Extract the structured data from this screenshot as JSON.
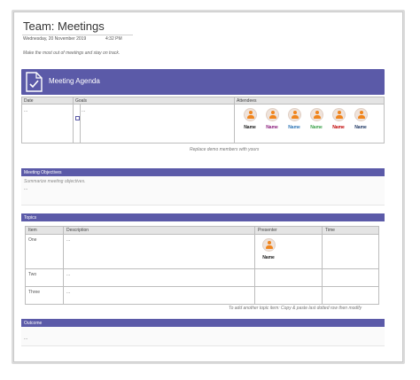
{
  "header": {
    "title": "Team: Meetings",
    "date": "Wednesday, 20 November 2019",
    "time": "4:32 PM",
    "subtitle": "Make the most out of meetings and stay on track."
  },
  "banner": {
    "title": "Meeting Agenda",
    "icon": "clipboard-check-icon"
  },
  "agenda": {
    "headers": {
      "date": "Date",
      "goals": "Goals",
      "attendees": "Attendees"
    },
    "date_value": "...",
    "goals_value": "...",
    "attendees": [
      {
        "name": "Name",
        "color": "#1a1a1a"
      },
      {
        "name": "Name",
        "color": "#8a1c7c"
      },
      {
        "name": "Name",
        "color": "#2e75b6"
      },
      {
        "name": "Name",
        "color": "#3aa14a"
      },
      {
        "name": "Name",
        "color": "#c00000"
      },
      {
        "name": "Name",
        "color": "#1f3864"
      }
    ],
    "caption": "Replace demo members with yours"
  },
  "objectives": {
    "title": "Meeting Objectives",
    "placeholder": "Summarize meeting objectives.",
    "value": "..."
  },
  "topics": {
    "title": "Topics",
    "headers": {
      "item": "Item",
      "description": "Description",
      "presenter": "Presenter",
      "time": "Time"
    },
    "rows": [
      {
        "item": "One",
        "description": "...",
        "presenter": "Name"
      },
      {
        "item": "Two",
        "description": "..."
      },
      {
        "item": "Three",
        "description": "..."
      }
    ],
    "caption": "To add another topic item: Copy & paste last dotted row then modify"
  },
  "outcome": {
    "title": "Outcome",
    "value": "..."
  },
  "colors": {
    "accent": "#5b5aa8",
    "avatar": "#f0851d"
  }
}
